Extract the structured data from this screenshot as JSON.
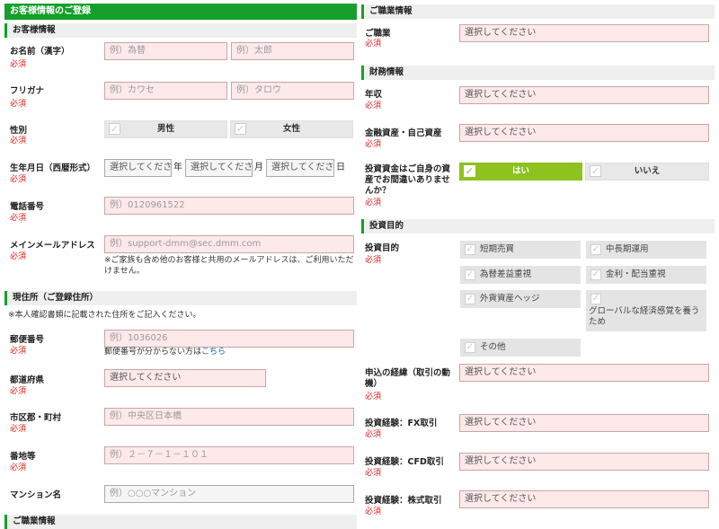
{
  "left": {
    "main_title": "お客様情報のご登録",
    "section_customer": "お客様情報",
    "required": "必須",
    "name_label": "お名前（漢字）",
    "name_last_placeholder": "例）為替",
    "name_first_placeholder": "例）太郎",
    "kana_label": "フリガナ",
    "kana_last_placeholder": "例）カワセ",
    "kana_first_placeholder": "例）タロウ",
    "gender_label": "性別",
    "gender_male": "男性",
    "gender_female": "女性",
    "birth_label": "生年月日（西暦形式）",
    "birth_year": "選択してください",
    "birth_month": "選択してください",
    "birth_day": "選択してください",
    "unit_year": "年",
    "unit_month": "月",
    "unit_day": "日",
    "phone_label": "電話番号",
    "phone_placeholder": "例）0120961522",
    "email_label": "メインメールアドレス",
    "email_placeholder": "例）support-dmm@sec.dmm.com",
    "email_note": "※ご家族も含め他のお客様と共用のメールアドレスは、ご利用いただけません。",
    "section_address": "現住所（ご登録住所）",
    "address_note": "※本人確認書類に記載された住所をご記入ください。",
    "postal_label": "郵便番号",
    "postal_placeholder": "例）1036026",
    "postal_help": "郵便番号が分からない方は",
    "postal_link": "こちら",
    "pref_label": "都道府県",
    "pref_select": "選択してください",
    "city_label": "市区郡・町村",
    "city_placeholder": "例）中央区日本橋",
    "street_label": "番地等",
    "street_placeholder": "例）２－７－１－１０１",
    "mansion_label": "マンション名",
    "mansion_placeholder": "例）○○○マンション",
    "section_job_bottom": "ご職業情報"
  },
  "right": {
    "section_job": "ご職業情報",
    "required": "必須",
    "job_label": "ご職業",
    "job_select": "選択してください",
    "section_finance": "財務情報",
    "income_label": "年収",
    "income_select": "選択してください",
    "assets_label": "金融資産・自己資産",
    "assets_select": "選択してください",
    "funds_label": "投資資金はご自身の資産でお間違いありませんか？",
    "funds_yes": "はい",
    "funds_no": "いいえ",
    "section_purpose": "投資目的",
    "purpose_label": "投資目的",
    "purpose_options": [
      "短期売買",
      "中長期運用",
      "為替差益重視",
      "金利・配当重視",
      "外貨資産ヘッジ",
      "グローバルな経済感覚を養うため",
      "その他"
    ],
    "motive_label": "申込の経緯（取引の動機）",
    "motive_select": "選択してください",
    "fx_label": "投資経験：FX取引",
    "fx_select": "選択してください",
    "cfd_label": "投資経験：CFD取引",
    "cfd_select": "選択してください",
    "stock_label": "投資経験：株式取引",
    "stock_select": "選択してください"
  },
  "colors": {
    "accent_green": "#14a02a",
    "toggle_on": "#8dc21f",
    "input_bg": "#fde9ea",
    "required_red": "#e02020",
    "link_blue": "#1a5fc1"
  },
  "icons": {
    "checkbox": "check-mark-icon"
  }
}
